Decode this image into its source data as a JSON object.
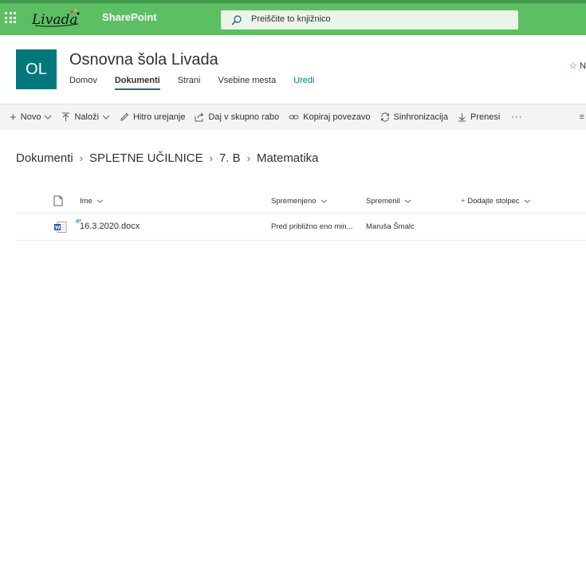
{
  "suite": {
    "logo_text": "Livada",
    "app_name": "SharePoint",
    "search_placeholder": "Preiščite to knjižnico"
  },
  "site": {
    "logo_initials": "OL",
    "title": "Osnovna šola Livada",
    "nav": [
      {
        "label": "Domov"
      },
      {
        "label": "Dokumenti"
      },
      {
        "label": "Strani"
      },
      {
        "label": "Vsebine mesta"
      },
      {
        "label": "Uredi"
      }
    ],
    "follow_label": "N"
  },
  "commandbar": {
    "new_label": "Novo",
    "upload_label": "Naloži",
    "quick_edit_label": "Hitro urejanje",
    "share_label": "Daj v skupno rabo",
    "copy_link_label": "Kopiraj povezavo",
    "sync_label": "Sinhronizacija",
    "download_label": "Prenesi",
    "more_label": "···"
  },
  "breadcrumb": {
    "items": [
      "Dokumenti",
      "SPLETNE UČILNICE",
      "7. B",
      "Matematika"
    ]
  },
  "list": {
    "columns": {
      "name": "Ime",
      "modified": "Spremenjeno",
      "modified_by": "Spremenil",
      "add_column": "Dodajte stolpec"
    },
    "rows": [
      {
        "name": "16.3.2020.docx",
        "modified": "Pred približno eno min...",
        "modified_by": "Maruša Šmalc",
        "icon": "word-file-icon"
      }
    ]
  },
  "colors": {
    "suite_bar": "#5cbf63",
    "site_logo": "#03787c",
    "accent": "#03787c"
  }
}
